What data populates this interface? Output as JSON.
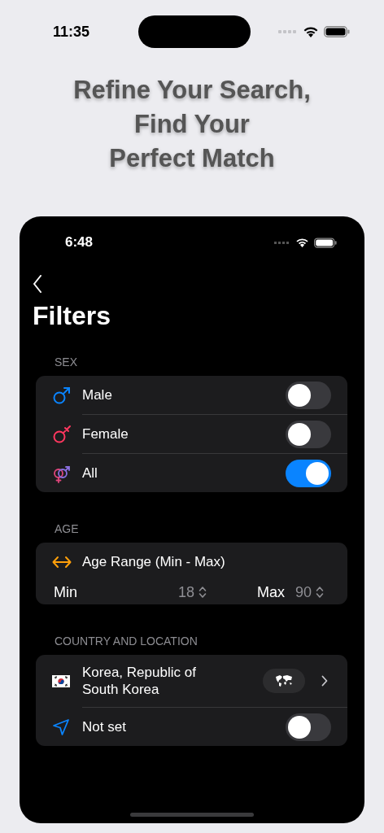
{
  "status_bar": {
    "time": "11:35"
  },
  "headline": [
    "Refine Your Search,",
    "Find Your",
    "Perfect Match"
  ],
  "screen": {
    "status_bar": {
      "time": "6:48"
    },
    "title": "Filters",
    "sections": [
      {
        "header": "SEX",
        "rows": [
          {
            "kind": "toggle",
            "label": "Male",
            "on": false
          },
          {
            "kind": "toggle",
            "label": "Female",
            "on": false
          },
          {
            "kind": "toggle",
            "label": "All",
            "on": true
          }
        ]
      },
      {
        "header": "AGE",
        "rows": [
          {
            "kind": "range",
            "label": "Age Range (Min - Max)",
            "min_label": "Min",
            "min_value": "18",
            "max_label": "Max",
            "max_value": "90"
          }
        ]
      },
      {
        "header": "COUNTRY AND LOCATION",
        "rows": [
          {
            "kind": "country",
            "lines": [
              "Korea, Republic of",
              "South Korea"
            ]
          },
          {
            "kind": "toggle",
            "label": "Not set",
            "on": false
          }
        ]
      }
    ]
  }
}
